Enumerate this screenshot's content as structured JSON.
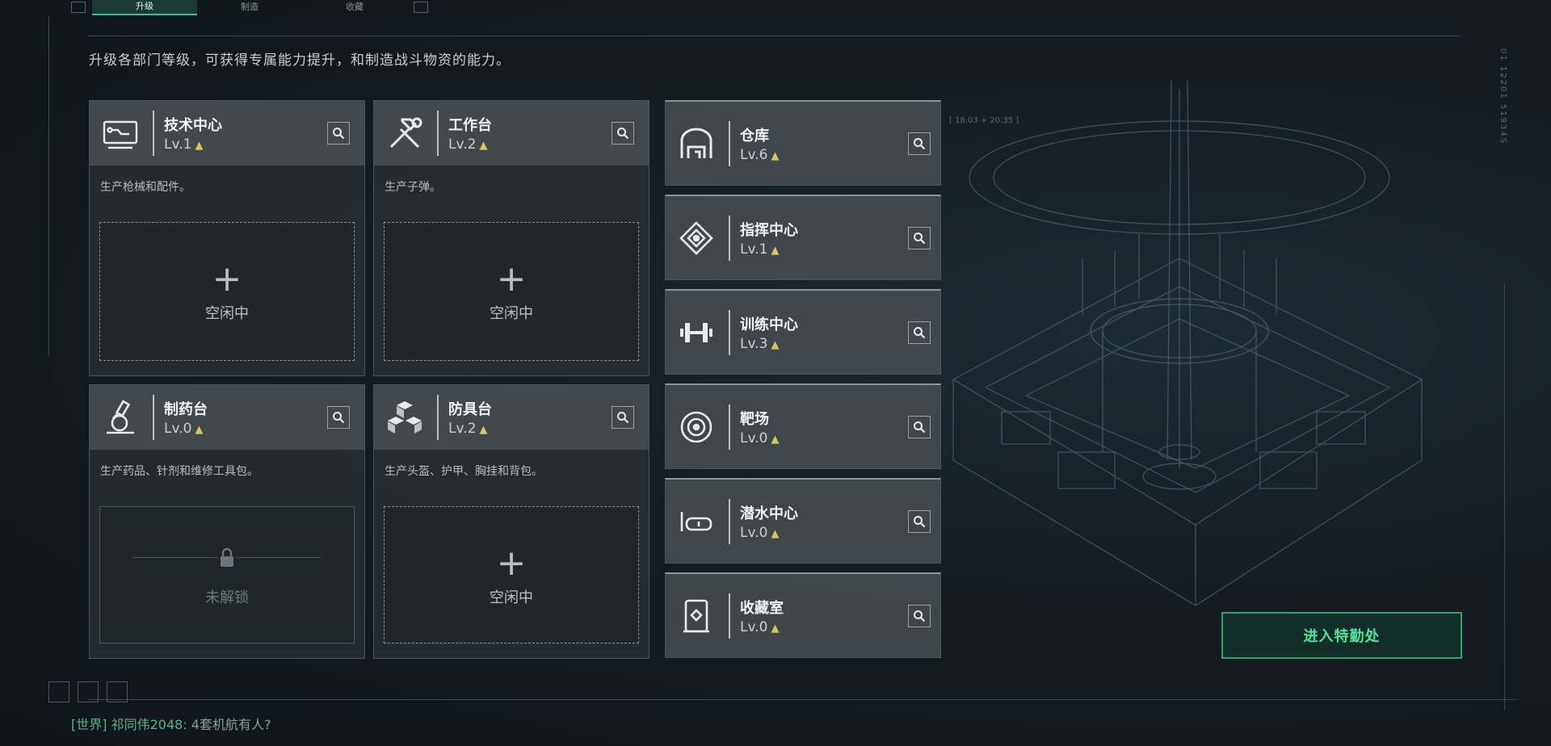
{
  "tabs": [
    {
      "label": "升级",
      "active": true
    },
    {
      "label": "制造",
      "active": false
    },
    {
      "label": "收藏",
      "active": false
    }
  ],
  "description": "升级各部门等级，可获得专属能力提升，和制造战斗物资的能力。",
  "left_cards": [
    {
      "name": "技术中心",
      "level": "Lv.1",
      "product": "生产枪械和配件。",
      "slot": "空闲中",
      "locked": false,
      "icon": "tech-center-icon"
    },
    {
      "name": "工作台",
      "level": "Lv.2",
      "product": "生产子弹。",
      "slot": "空闲中",
      "locked": false,
      "icon": "hammer-wrench-icon"
    },
    {
      "name": "制药台",
      "level": "Lv.0",
      "product": "生产药品、针剂和维修工具包。",
      "slot": "未解锁",
      "locked": true,
      "icon": "microscope-icon"
    },
    {
      "name": "防具台",
      "level": "Lv.2",
      "product": "生产头盔、护甲、胸挂和背包。",
      "slot": "空闲中",
      "locked": false,
      "icon": "cubes-icon"
    }
  ],
  "right_cards": [
    {
      "name": "仓库",
      "level": "Lv.6",
      "icon": "warehouse-icon"
    },
    {
      "name": "指挥中心",
      "level": "Lv.1",
      "icon": "command-center-icon"
    },
    {
      "name": "训练中心",
      "level": "Lv.3",
      "icon": "dumbbell-icon"
    },
    {
      "name": "靶场",
      "level": "Lv.0",
      "icon": "target-icon"
    },
    {
      "name": "潜水中心",
      "level": "Lv.0",
      "icon": "diving-mask-icon"
    },
    {
      "name": "收藏室",
      "level": "Lv.0",
      "icon": "display-case-icon"
    }
  ],
  "enter_button": "进入特勤处",
  "chat": {
    "channel": "[世界]",
    "user": "祁同伟2048",
    "message": ": 4套机航有人?"
  },
  "side_text": "01  12201  51934S",
  "coord_text": "[ 18.03 + 20.35 ]",
  "colors": {
    "accent": "#3ec487",
    "level_chevron": "#d8c85a",
    "enter_text": "#4fe39a"
  }
}
